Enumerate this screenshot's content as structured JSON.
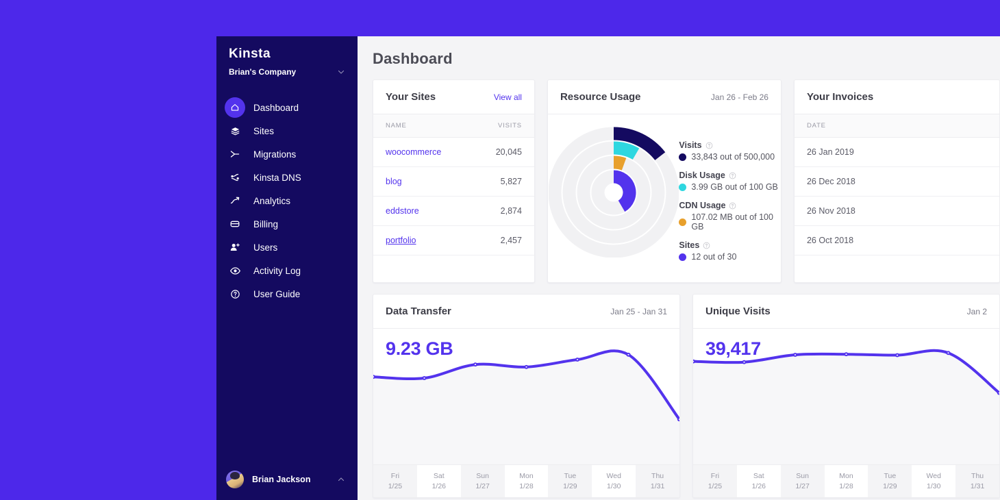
{
  "theme": {
    "bg_purple": "#4d28ea",
    "sidebar_navy": "#140a60",
    "accent_purple": "#5333ed",
    "cyan": "#2ed7e0",
    "orange": "#e8a02c",
    "navy_dark": "#140a60"
  },
  "sidebar": {
    "logo": "Kinsta",
    "company": "Brian's Company",
    "company_chevron_icon": "chevron-down-icon",
    "items": [
      {
        "label": "Dashboard",
        "icon": "home-icon",
        "active": true
      },
      {
        "label": "Sites",
        "icon": "layers-icon",
        "active": false
      },
      {
        "label": "Migrations",
        "icon": "migrate-icon",
        "active": false
      },
      {
        "label": "Kinsta DNS",
        "icon": "dns-icon",
        "active": false
      },
      {
        "label": "Analytics",
        "icon": "trend-up-icon",
        "active": false
      },
      {
        "label": "Billing",
        "icon": "credit-card-icon",
        "active": false
      },
      {
        "label": "Users",
        "icon": "user-add-icon",
        "active": false
      },
      {
        "label": "Activity Log",
        "icon": "eye-icon",
        "active": false
      },
      {
        "label": "User Guide",
        "icon": "question-circle-icon",
        "active": false
      }
    ],
    "user": {
      "name": "Brian Jackson",
      "avatar_icon": "avatar",
      "chevron_icon": "chevron-up-icon"
    }
  },
  "header": {
    "title": "Dashboard"
  },
  "sites_card": {
    "title": "Your Sites",
    "view_all": "View all",
    "columns": [
      "NAME",
      "VISITS"
    ],
    "rows": [
      {
        "name": "woocommerce",
        "visits": "20,045",
        "hover": false
      },
      {
        "name": "blog",
        "visits": "5,827",
        "hover": false
      },
      {
        "name": "eddstore",
        "visits": "2,874",
        "hover": false
      },
      {
        "name": "portfolio",
        "visits": "2,457",
        "hover": true
      }
    ]
  },
  "resource_card": {
    "title": "Resource Usage",
    "date_range": "Jan 26 - Feb 26",
    "help_icon": "question-circle-icon",
    "metrics": [
      {
        "label": "Visits",
        "value": "33,843 out of 500,000",
        "color": "#140a60",
        "pct": 6.8
      },
      {
        "label": "Disk Usage",
        "value": "3.99 GB out of 100 GB",
        "color": "#2ed7e0",
        "pct": 4.0
      },
      {
        "label": "CDN Usage",
        "value": "107.02 MB out of 100 GB",
        "color": "#e8a02c",
        "pct": 2.6
      },
      {
        "label": "Sites",
        "value": "12 out of 30",
        "color": "#5333ed",
        "pct": 40.0
      }
    ]
  },
  "invoices_card": {
    "title": "Your Invoices",
    "columns": [
      "DATE"
    ],
    "rows": [
      "26 Jan 2019",
      "26 Dec 2018",
      "26 Nov 2018",
      "26 Oct 2018"
    ]
  },
  "chart_data": [
    {
      "type": "line",
      "title": "Data Transfer",
      "date_range": "Jan 25 - Jan 31",
      "total": "9.23 GB",
      "ylabel": "",
      "xlabel": "",
      "grid": false,
      "legend": "none",
      "categories": [
        "Fri 1/25",
        "Sat 1/26",
        "Sun 1/27",
        "Mon 1/28",
        "Tue 1/29",
        "Wed 1/30",
        "Thu 1/31"
      ],
      "x_days": [
        "Fri",
        "Sat",
        "Sun",
        "Mon",
        "Tue",
        "Wed",
        "Thu"
      ],
      "x_dates": [
        "1/25",
        "1/26",
        "1/27",
        "1/28",
        "1/29",
        "1/30",
        "1/31"
      ],
      "values": [
        1.42,
        1.4,
        1.62,
        1.58,
        1.7,
        1.78,
        0.73
      ],
      "ylim": [
        0,
        2.2
      ],
      "line_color": "#5333ed"
    },
    {
      "type": "line",
      "title": "Unique Visits",
      "date_range": "Jan 2",
      "total": "39,417",
      "ylabel": "",
      "xlabel": "",
      "grid": false,
      "legend": "none",
      "categories": [
        "Fri 1/25",
        "Sat 1/26",
        "Sun 1/27",
        "Mon 1/28",
        "Tue 1/29",
        "Wed 1/30",
        "Thu 1/31"
      ],
      "x_days": [
        "Fri",
        "Sat",
        "Sun",
        "Mon",
        "Tue",
        "Wed",
        "Thu"
      ],
      "x_dates": [
        "1/25",
        "1/26",
        "1/27",
        "1/28",
        "1/29",
        "1/30",
        "1/31"
      ],
      "values": [
        5620,
        5580,
        5980,
        6010,
        5960,
        6080,
        3900
      ],
      "ylim": [
        0,
        7400
      ],
      "line_color": "#5333ed"
    }
  ]
}
